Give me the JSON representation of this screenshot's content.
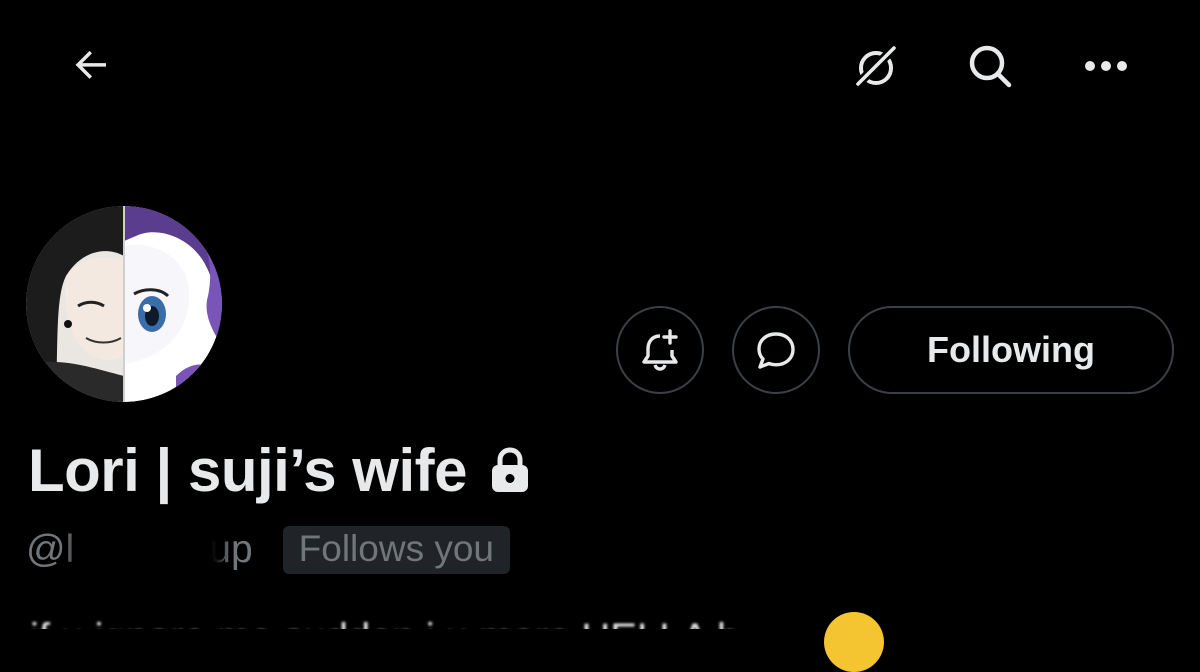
{
  "header": {
    "back_icon": "arrow-left-icon",
    "grok_icon": "grok-icon",
    "search_icon": "search-icon",
    "more_icon": "more-horizontal-icon"
  },
  "profile": {
    "avatar": "avatar",
    "display_name": "Lori | suji’s wife",
    "protected_icon": "lock-icon",
    "handle_prefix": "@l",
    "handle_suffix": "up",
    "follows_you": "Follows you",
    "bio_partial": "if u ignore me sudden i u more HELLA b"
  },
  "actions": {
    "notify_icon": "bell-plus-icon",
    "message_icon": "message-bubble-icon",
    "following_label": "Following"
  },
  "colors": {
    "background": "#000000",
    "text_primary": "#e7e9ea",
    "text_secondary": "#71767b",
    "border": "#3c4045",
    "badge_bg": "#202327"
  }
}
